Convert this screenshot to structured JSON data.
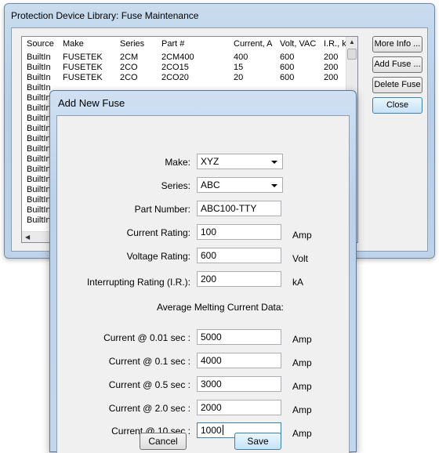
{
  "main": {
    "title": "Protection Device Library: Fuse Maintenance",
    "columns": [
      "Source",
      "Make",
      "Series",
      "Part #",
      "Current, A",
      "Volt, VAC",
      "I.R., kA"
    ],
    "rows": [
      [
        "BuiltIn",
        "FUSETEK",
        "2CM",
        "2CM400",
        "400",
        "600",
        "200"
      ],
      [
        "BuiltIn",
        "FUSETEK",
        "2CO",
        "2CO15",
        "15",
        "600",
        "200"
      ],
      [
        "BuiltIn",
        "FUSETEK",
        "2CO",
        "2CO20",
        "20",
        "600",
        "200"
      ]
    ],
    "source_only_rows": [
      "BuiltIn",
      "BuiltIn",
      "BuiltIn",
      "BuiltIn",
      "BuiltIn",
      "BuiltIn",
      "BuiltIn",
      "BuiltIn",
      "BuiltIn",
      "BuiltIn",
      "BuiltIn",
      "BuiltIn",
      "BuiltIn",
      "BuiltIn"
    ],
    "buttons": {
      "more_info": "More Info ...",
      "add_fuse": "Add Fuse ...",
      "delete_fuse": "Delete Fuse",
      "close": "Close"
    }
  },
  "dialog": {
    "title": "Add New Fuse",
    "make": {
      "label": "Make:",
      "value": "XYZ"
    },
    "series": {
      "label": "Series:",
      "value": "ABC"
    },
    "part_number": {
      "label": "Part Number:",
      "value": "ABC100-TTY"
    },
    "current_rating": {
      "label": "Current Rating:",
      "value": "100",
      "unit": "Amp"
    },
    "voltage_rating": {
      "label": "Voltage Rating:",
      "value": "600",
      "unit": "Volt"
    },
    "interrupting_rating": {
      "label": "Interrupting Rating (I.R.):",
      "value": "200",
      "unit": "kA"
    },
    "section_heading": "Average Melting Current Data:",
    "melting": [
      {
        "label": "Current @ 0.01 sec :",
        "value": "5000",
        "unit": "Amp"
      },
      {
        "label": "Current @ 0.1 sec :",
        "value": "4000",
        "unit": "Amp"
      },
      {
        "label": "Current @ 0.5 sec :",
        "value": "3000",
        "unit": "Amp"
      },
      {
        "label": "Current @ 2.0 sec :",
        "value": "2000",
        "unit": "Amp"
      },
      {
        "label": "Current @ 10 sec :",
        "value": "1000",
        "unit": "Amp"
      }
    ],
    "cancel_label": "Cancel",
    "save_label": "Save"
  }
}
